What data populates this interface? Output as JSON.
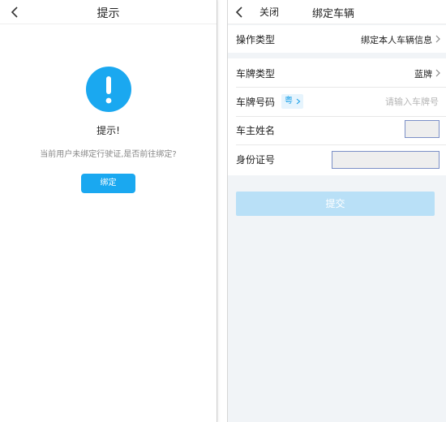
{
  "left": {
    "title": "提示",
    "alert_icon": "exclamation-circle-icon",
    "heading": "提示!",
    "message": "当前用户未绑定行驶证,是否前往绑定?",
    "bind_button": "绑定"
  },
  "right": {
    "close_label": "关闭",
    "title": "绑定车辆",
    "operation": {
      "label": "操作类型",
      "value": "绑定本人车辆信息"
    },
    "plate_type": {
      "label": "车牌类型",
      "value": "蓝牌"
    },
    "plate_number": {
      "label": "车牌号码",
      "province": "粤",
      "placeholder": "请输入车牌号"
    },
    "owner_name": {
      "label": "车主姓名",
      "value": ""
    },
    "id_number": {
      "label": "身份证号",
      "value": ""
    },
    "submit": "提交"
  },
  "colors": {
    "accent": "#1aa8f0",
    "submit_disabled": "#b9e0f7",
    "page_bg": "#f1f4f7"
  }
}
